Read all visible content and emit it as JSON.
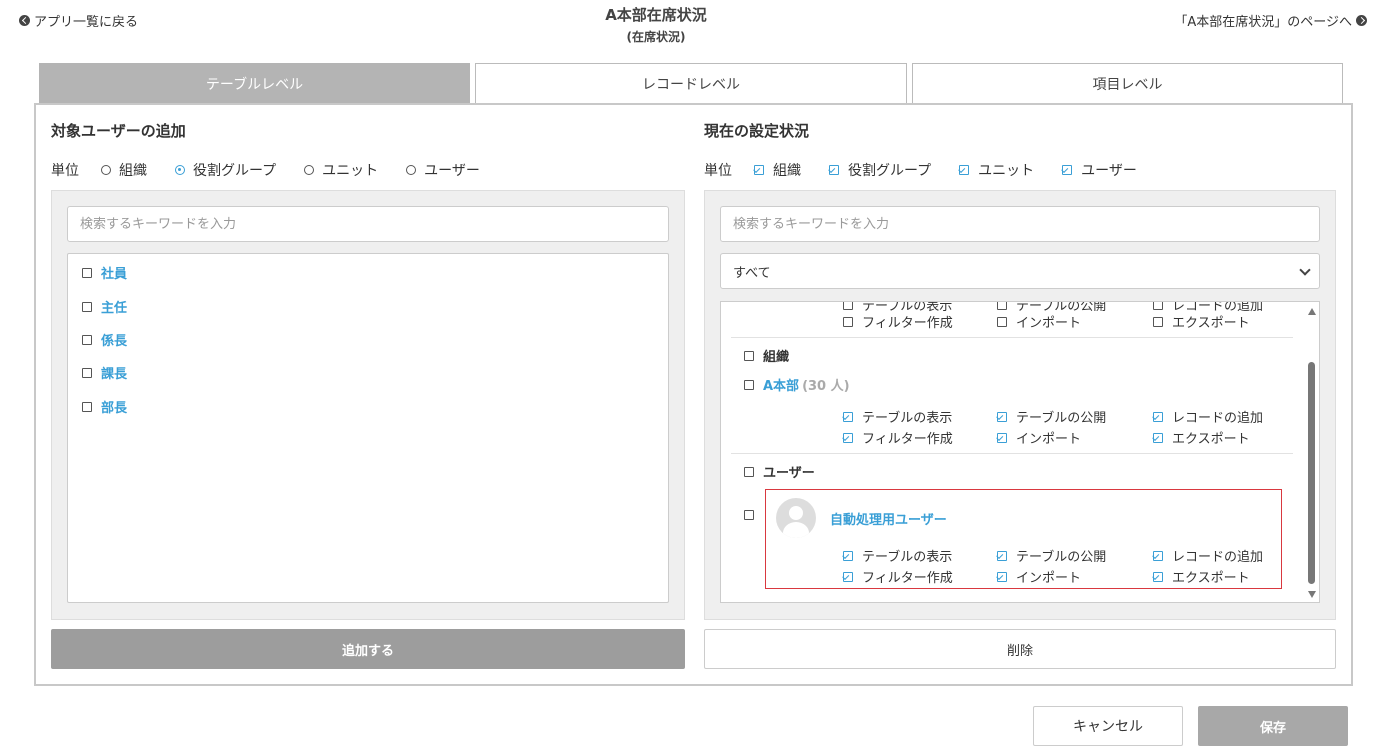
{
  "header": {
    "back_label": "アプリ一覧に戻る",
    "title": "A本部在席状況",
    "subtitle": "(在席状況)",
    "forward_label": "「A本部在席状況」のページへ"
  },
  "tabs": [
    {
      "label": "テーブルレベル",
      "active": true
    },
    {
      "label": "レコードレベル",
      "active": false
    },
    {
      "label": "項目レベル",
      "active": false
    }
  ],
  "left": {
    "title": "対象ユーザーの追加",
    "unit_label": "単位",
    "units": [
      {
        "label": "組織",
        "selected": false
      },
      {
        "label": "役割グループ",
        "selected": true
      },
      {
        "label": "ユニット",
        "selected": false
      },
      {
        "label": "ユーザー",
        "selected": false
      }
    ],
    "search_placeholder": "検索するキーワードを入力",
    "roles": [
      "社員",
      "主任",
      "係長",
      "課長",
      "部長"
    ],
    "add_button": "追加する"
  },
  "right": {
    "title": "現在の設定状況",
    "unit_label": "単位",
    "units": [
      {
        "label": "組織",
        "checked": true
      },
      {
        "label": "役割グループ",
        "checked": true
      },
      {
        "label": "ユニット",
        "checked": true
      },
      {
        "label": "ユーザー",
        "checked": true
      }
    ],
    "search_placeholder": "検索するキーワードを入力",
    "filter_value": "すべて",
    "partial_row": [
      "テーブルの表示",
      "テーブルの公開",
      "レコードの追加"
    ],
    "top_row": [
      "フィルター作成",
      "インポート",
      "エクスポート"
    ],
    "org_group_label": "組織",
    "org_name": "A本部",
    "org_count": "(30 人)",
    "org_perms_row1": [
      "テーブルの表示",
      "テーブルの公開",
      "レコードの追加"
    ],
    "org_perms_row2": [
      "フィルター作成",
      "インポート",
      "エクスポート"
    ],
    "user_group_label": "ユーザー",
    "user_name": "自動処理用ユーザー",
    "user_perms_row1": [
      "テーブルの表示",
      "テーブルの公開",
      "レコードの追加"
    ],
    "user_perms_row2": [
      "フィルター作成",
      "インポート",
      "エクスポート"
    ],
    "delete_button": "削除"
  },
  "footer": {
    "cancel_label": "キャンセル",
    "save_label": "保存"
  },
  "colors": {
    "accent": "#3a9fd6",
    "highlight": "#d9383f",
    "active_tab": "#b4b4b4",
    "button_gray": "#9d9d9d"
  }
}
